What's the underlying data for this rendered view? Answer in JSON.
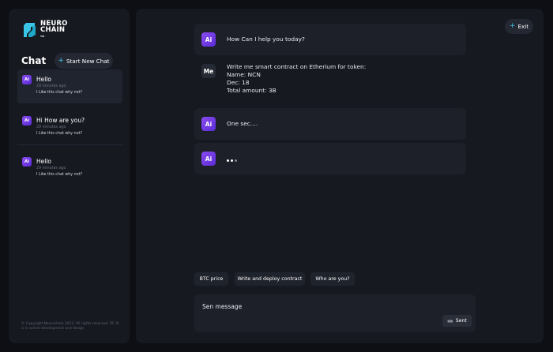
{
  "brand": {
    "line1": "NEURO",
    "line2": "CHAIN",
    "tm": "TM"
  },
  "sidebar": {
    "title": "Chat",
    "new_chat_label": "Start New Chat",
    "chats": [
      {
        "badge": "Ai",
        "title": "Hello",
        "time": "29 minutes ago",
        "preview": "I Like this chat why not?"
      },
      {
        "badge": "Ai",
        "title": "Hi How are you?",
        "time": "29 minutes ago",
        "preview": "I Like this chat why not?"
      },
      {
        "badge": "Ai",
        "title": "Hello",
        "time": "29 minutes ago",
        "preview": "I Like this chat why not?"
      }
    ],
    "footer": "© Copyright Neurochain 2023. All rights reserved. RC AI is in active development and design"
  },
  "header": {
    "exit_label": "Exit"
  },
  "messages": [
    {
      "role": "ai",
      "badge": "Ai",
      "text": "How Can I help you today?"
    },
    {
      "role": "me",
      "badge": "Me",
      "lines": [
        "Write me smart contract on Etherium for token:",
        "Name: NCN",
        "Dec: 18",
        "Total amount: 3B"
      ]
    },
    {
      "role": "ai",
      "badge": "Ai",
      "text": "One sec...."
    },
    {
      "role": "ai",
      "badge": "Ai",
      "typing": true
    }
  ],
  "suggestions": [
    "BTC price",
    "Write and deploy contract",
    "Who are you?"
  ],
  "composer": {
    "placeholder": "Sen message",
    "send_label": "Sent"
  },
  "colors": {
    "background": "#0d0f14",
    "panel": "#161920",
    "accent": "#3fc8e8",
    "ai_badge": "#7b3fe4"
  }
}
